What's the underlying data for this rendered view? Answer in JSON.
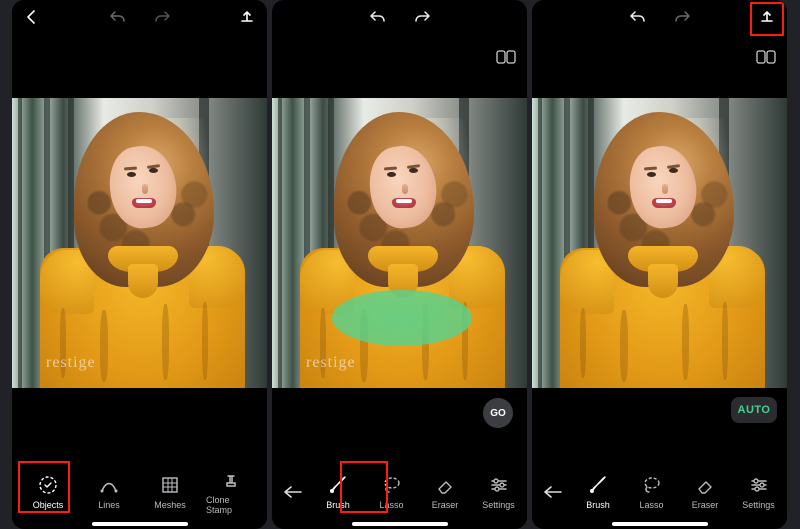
{
  "watermark_text": "restige",
  "panels": {
    "p1": {
      "tools": {
        "objects": "Objects",
        "lines": "Lines",
        "meshes": "Meshes",
        "clone_stamp": "Clone Stamp"
      }
    },
    "p2": {
      "go_label": "GO",
      "tools": {
        "brush": "Brush",
        "lasso": "Lasso",
        "eraser": "Eraser",
        "settings": "Settings"
      }
    },
    "p3": {
      "auto_label": "AUTO",
      "tools": {
        "brush": "Brush",
        "lasso": "Lasso",
        "eraser": "Eraser",
        "settings": "Settings"
      }
    }
  }
}
